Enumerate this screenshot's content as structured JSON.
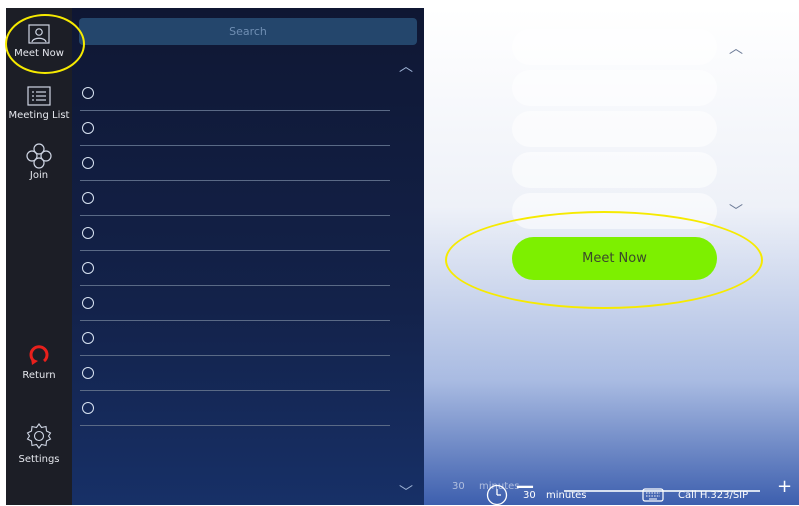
{
  "nav": {
    "items": [
      {
        "label": "Meet Now"
      },
      {
        "label": "Meeting List"
      },
      {
        "label": "Join"
      },
      {
        "label": "Return"
      },
      {
        "label": "Settings"
      }
    ]
  },
  "list": {
    "search_placeholder": "Search",
    "row_count": 10
  },
  "right": {
    "meet_now_button": "Meet Now"
  },
  "bottom": {
    "ghost_duration_value": "30",
    "ghost_duration_unit": "minutes",
    "duration_value": "30",
    "duration_unit": "minutes",
    "minus_symbol": "—",
    "plus_symbol": "+",
    "call_label": "Call H.323/SIP"
  },
  "colors": {
    "accent_green": "#7df000",
    "annotation_yellow": "#f6ea00",
    "return_red": "#e8201c"
  }
}
